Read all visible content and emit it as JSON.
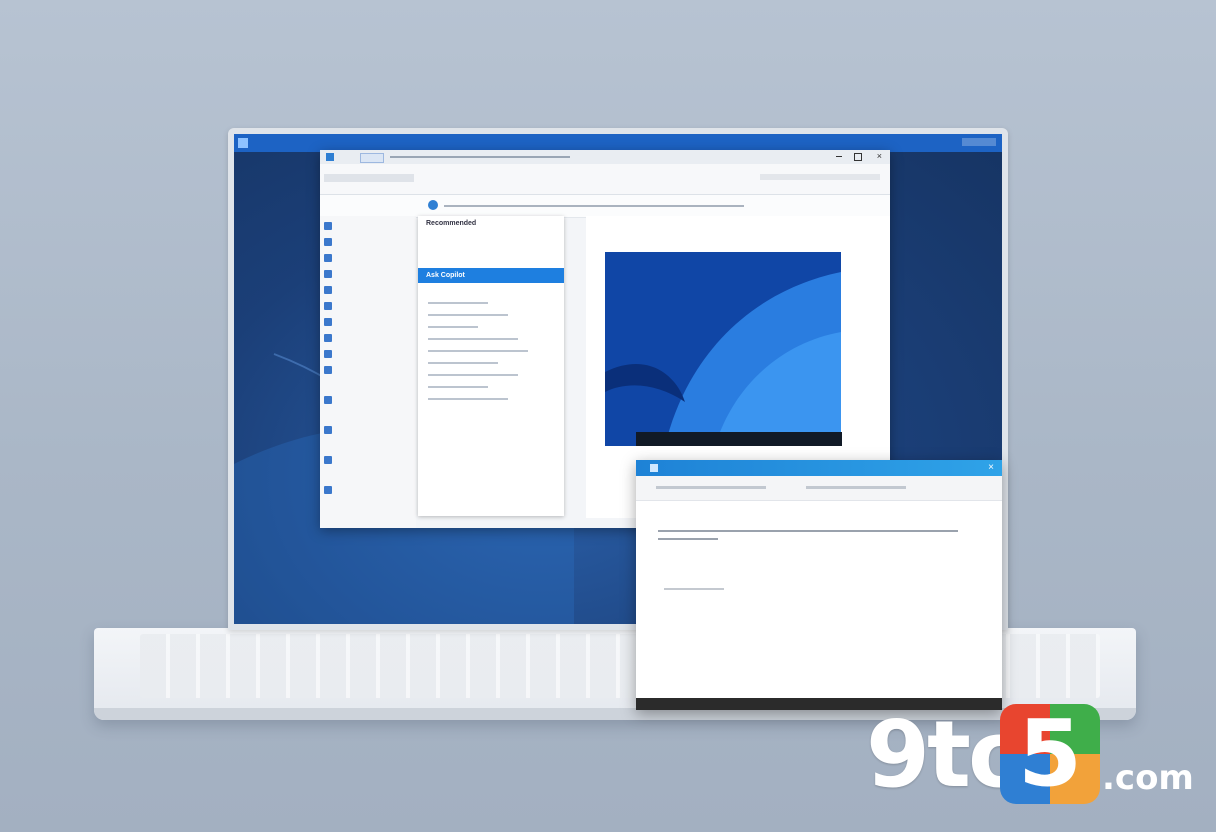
{
  "explorer": {
    "panel_title": "Recommended",
    "selected_item": "Ask Copilot"
  },
  "logo": {
    "digit": "9",
    "to": "to",
    "five": "5",
    "com": ".com"
  },
  "colors": {
    "accent": "#1e7fe0",
    "logo_red": "#e8452f",
    "logo_green": "#3fae4a",
    "logo_blue": "#2f7fd3",
    "logo_orange": "#f2a23a"
  },
  "icons": [
    "windows-start-icon",
    "folder-icon",
    "search-icon",
    "close-icon",
    "minimize-icon",
    "maximize-icon"
  ]
}
